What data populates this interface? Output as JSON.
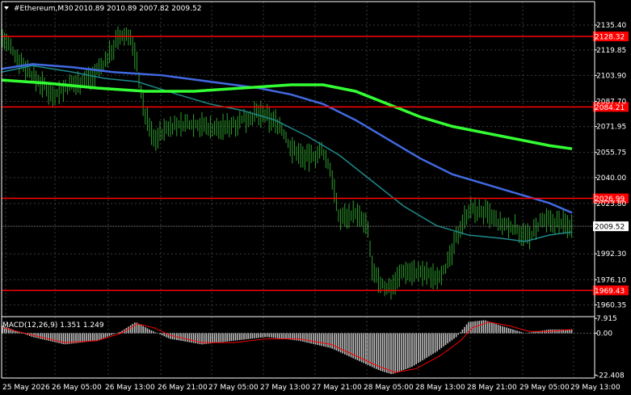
{
  "header": {
    "menu_icon": "triangle-down-icon",
    "symbol": "#Ethereum,M30",
    "ohlc": "2010.89 2010.89 2007.82 2009.52"
  },
  "indicator": {
    "label": "MACD(12,26,9) 1.351 1.249",
    "axis_ticks": [
      "7.915",
      "0.00",
      "-22.408"
    ]
  },
  "price_axis": {
    "ticks": [
      "2135.40",
      "2119.85",
      "2103.90",
      "2087.70",
      "2071.95",
      "2055.75",
      "2040.00",
      "2023.80",
      "1992.30",
      "1976.10",
      "1960.35"
    ],
    "current_price": "2009.52"
  },
  "levels": [
    {
      "label": "2128.32"
    },
    {
      "label": "2084.21"
    },
    {
      "label": "2026.99"
    },
    {
      "label": "1969.43"
    }
  ],
  "time_axis": [
    "25 May 2026",
    "26 May 05:00",
    "26 May 13:00",
    "26 May 21:00",
    "27 May 05:00",
    "27 May 13:00",
    "27 May 21:00",
    "28 May 05:00",
    "28 May 13:00",
    "28 May 21:00",
    "29 May 05:00",
    "29 May 13:00"
  ],
  "colors": {
    "background": "#000000",
    "grid": "#3a3a3a",
    "bars": "#2ea02e",
    "level_line": "#ff0000",
    "level_label_bg": "#ff0000",
    "ma_fast": "#1d8a8a",
    "ma_mid": "#4169e1",
    "ma_slow": "#33ff33",
    "macd_hist": "#c0c0c0",
    "macd_signal": "#ff0000",
    "current_price_bg": "#ffffff"
  }
}
